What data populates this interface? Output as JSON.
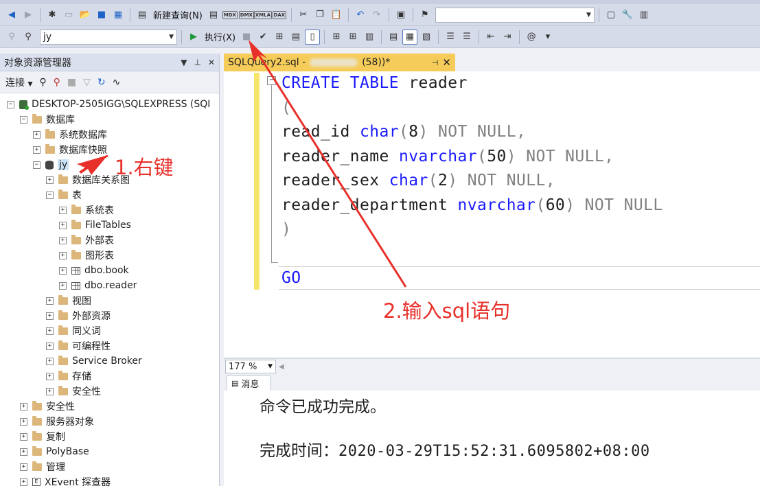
{
  "toolbar1": {
    "new_query_label": "新建查询(N)",
    "tags": [
      "MDX",
      "DMX",
      "XMLA",
      "DAX"
    ],
    "search_value": ""
  },
  "toolbar2": {
    "database_value": "jy",
    "execute_label": "执行(X)"
  },
  "object_explorer": {
    "title": "对象资源管理器",
    "connect_label": "连接",
    "nodes": [
      {
        "label": "DESKTOP-2505IGG\\SQLEXPRESS (SQI",
        "expander": "−",
        "icon": "server-icon"
      },
      {
        "label": "数据库",
        "expander": "−",
        "icon": "folder-icon"
      },
      {
        "label": "系统数据库",
        "expander": "+",
        "icon": "folder-icon"
      },
      {
        "label": "数据库快照",
        "expander": "+",
        "icon": "folder-icon"
      },
      {
        "label": "jy",
        "expander": "−",
        "icon": "database-icon"
      },
      {
        "label": "数据库关系图",
        "expander": "+",
        "icon": "folder-icon"
      },
      {
        "label": "表",
        "expander": "−",
        "icon": "folder-icon"
      },
      {
        "label": "系统表",
        "expander": "+",
        "icon": "folder-icon"
      },
      {
        "label": "FileTables",
        "expander": "+",
        "icon": "folder-icon"
      },
      {
        "label": "外部表",
        "expander": "+",
        "icon": "folder-icon"
      },
      {
        "label": "图形表",
        "expander": "+",
        "icon": "folder-icon"
      },
      {
        "label": "dbo.book",
        "expander": "+",
        "icon": "table-icon"
      },
      {
        "label": "dbo.reader",
        "expander": "+",
        "icon": "table-icon"
      },
      {
        "label": "视图",
        "expander": "+",
        "icon": "folder-icon"
      },
      {
        "label": "外部资源",
        "expander": "+",
        "icon": "folder-icon"
      },
      {
        "label": "同义词",
        "expander": "+",
        "icon": "folder-icon"
      },
      {
        "label": "可编程性",
        "expander": "+",
        "icon": "folder-icon"
      },
      {
        "label": "Service Broker",
        "expander": "+",
        "icon": "folder-icon"
      },
      {
        "label": "存储",
        "expander": "+",
        "icon": "folder-icon"
      },
      {
        "label": "安全性",
        "expander": "+",
        "icon": "folder-icon"
      },
      {
        "label": "安全性",
        "expander": "+",
        "icon": "folder-icon"
      },
      {
        "label": "服务器对象",
        "expander": "+",
        "icon": "folder-icon"
      },
      {
        "label": "复制",
        "expander": "+",
        "icon": "folder-icon"
      },
      {
        "label": "PolyBase",
        "expander": "+",
        "icon": "folder-icon"
      },
      {
        "label": "管理",
        "expander": "+",
        "icon": "folder-icon"
      },
      {
        "label": "XEvent 探查器",
        "expander": "+",
        "icon": "xevent-icon"
      }
    ]
  },
  "editor": {
    "tab_title_start": "SQLQuery2.sql -",
    "tab_title_end": "(58))*",
    "lines": [
      [
        {
          "t": "CREATE TABLE",
          "c": "kw"
        },
        {
          "t": " reader",
          "c": "pl"
        }
      ],
      [
        {
          "t": "(",
          "c": "gr"
        }
      ],
      [
        {
          "t": "read_id ",
          "c": "pl"
        },
        {
          "t": "char",
          "c": "kw"
        },
        {
          "t": "(",
          "c": "gr"
        },
        {
          "t": "8",
          "c": "pl"
        },
        {
          "t": ") NOT NULL,",
          "c": "gr"
        }
      ],
      [
        {
          "t": "reader_name ",
          "c": "pl"
        },
        {
          "t": "nvarchar",
          "c": "kw"
        },
        {
          "t": "(",
          "c": "gr"
        },
        {
          "t": "50",
          "c": "pl"
        },
        {
          "t": ") NOT NULL,",
          "c": "gr"
        }
      ],
      [
        {
          "t": "reader_sex ",
          "c": "pl"
        },
        {
          "t": "char",
          "c": "kw"
        },
        {
          "t": "(",
          "c": "gr"
        },
        {
          "t": "2",
          "c": "pl"
        },
        {
          "t": ") NOT NULL,",
          "c": "gr"
        }
      ],
      [
        {
          "t": "reader_department ",
          "c": "pl"
        },
        {
          "t": "nvarchar",
          "c": "kw"
        },
        {
          "t": "(",
          "c": "gr"
        },
        {
          "t": "60",
          "c": "pl"
        },
        {
          "t": ") NOT NULL",
          "c": "gr"
        }
      ],
      [
        {
          "t": ")",
          "c": "gr"
        }
      ],
      [],
      [
        {
          "t": "GO",
          "c": "kw"
        }
      ]
    ]
  },
  "zoom": {
    "value": "177 %"
  },
  "results": {
    "tab_label": "消息",
    "message": "命令已成功完成。",
    "completion_label": "完成时间：",
    "completion_time": "2020-03-29T15:52:31.6095802+08:00"
  },
  "annotations": {
    "step1": "1.右键",
    "step2": "2.输入sql语句"
  },
  "colors": {
    "keyword": "#1a1aff",
    "operator": "#808080",
    "annotation": "#e8302a",
    "active_tab": "#f5cc5a"
  }
}
